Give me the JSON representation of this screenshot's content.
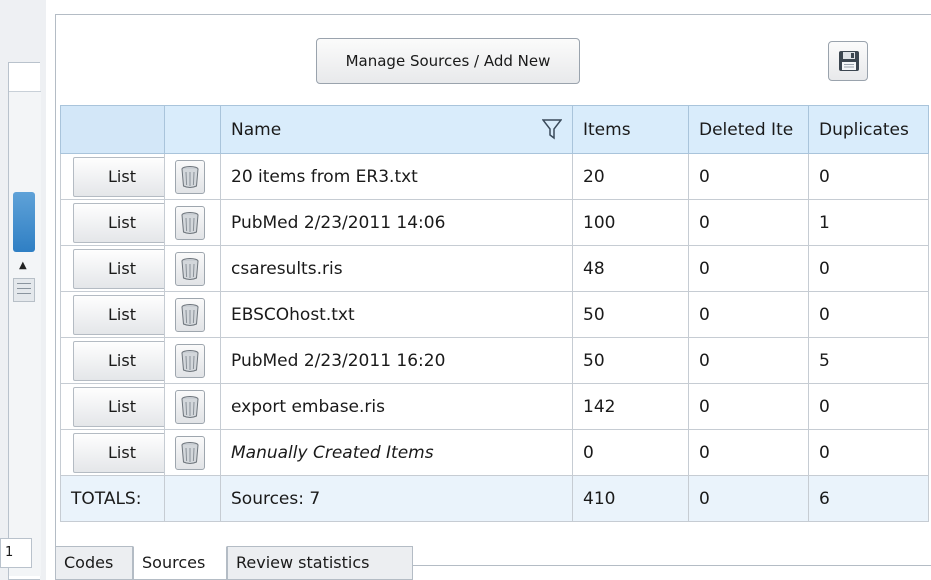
{
  "left_panel": {
    "row_number": "1"
  },
  "toolbar": {
    "manage_sources_label": "Manage Sources / Add New",
    "save_icon": "floppy-disk-icon"
  },
  "grid": {
    "columns": [
      "",
      "",
      "Name",
      "Items",
      "Deleted Ite",
      "Duplicates"
    ],
    "rows": [
      {
        "button": "List",
        "name": "20 items from ER3.txt",
        "items": "20",
        "deleted": "0",
        "duplicates": "0"
      },
      {
        "button": "List",
        "name": "PubMed  2/23/2011 14:06",
        "items": "100",
        "deleted": "0",
        "duplicates": "1"
      },
      {
        "button": "List",
        "name": "csaresults.ris",
        "items": "48",
        "deleted": "0",
        "duplicates": "0"
      },
      {
        "button": "List",
        "name": "EBSCOhost.txt",
        "items": "50",
        "deleted": "0",
        "duplicates": "0"
      },
      {
        "button": "List",
        "name": "PubMed  2/23/2011 16:20",
        "items": "50",
        "deleted": "0",
        "duplicates": "5"
      },
      {
        "button": "List",
        "name": "export embase.ris",
        "items": "142",
        "deleted": "0",
        "duplicates": "0"
      },
      {
        "button": "List",
        "name": "Manually Created Items",
        "items": "0",
        "deleted": "0",
        "duplicates": "0"
      }
    ],
    "totals": {
      "label": "TOTALS:",
      "sources": "Sources: 7",
      "items": "410",
      "deleted": "0",
      "duplicates": "6"
    }
  },
  "tabs": [
    {
      "label": "Codes",
      "active": false
    },
    {
      "label": "Sources",
      "active": true
    },
    {
      "label": "Review statistics",
      "active": false
    }
  ],
  "colors": {
    "header_bg": "#d9ecfb",
    "totals_bg": "#eaf3fb",
    "scroll_thumb": "#2f7fc4"
  }
}
